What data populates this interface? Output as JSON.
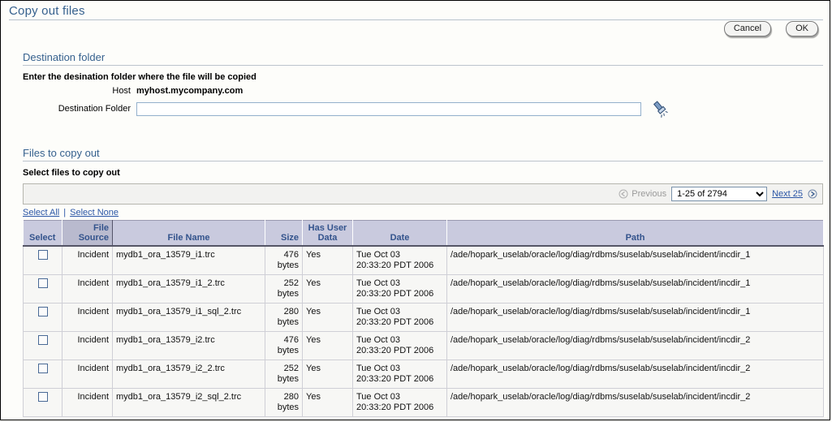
{
  "page": {
    "title": "Copy out files"
  },
  "top_actions": {
    "cancel_label": "Cancel",
    "ok_label": "OK"
  },
  "destination": {
    "section_title": "Destination folder",
    "instruction": "Enter the desination folder where the file will be copied",
    "host_label": "Host",
    "host_value": "myhost.mycompany.com",
    "folder_label": "Destination Folder",
    "folder_value": "",
    "folder_placeholder": "",
    "picker_icon": "flashlight-icon"
  },
  "files_section": {
    "section_title": "Files to copy out",
    "subtitle": "Select files to copy out"
  },
  "pagination": {
    "previous_label": "Previous",
    "previous_icon": "circle-left-arrow-icon",
    "range_value": "1-25 of 2794",
    "range_options": [
      "1-25 of 2794"
    ],
    "next_label": "Next 25",
    "next_icon": "circle-right-arrow-icon"
  },
  "selection_links": {
    "select_all": "Select All",
    "separator": "|",
    "select_none": "Select None"
  },
  "table": {
    "columns": [
      "Select",
      "File Source",
      "File Name",
      "Size",
      "Has User Data",
      "Date",
      "Path"
    ],
    "sorted_column": "File Source",
    "rows": [
      {
        "selected": false,
        "file_source": "Incident",
        "file_name": "mydb1_ora_13579_i1.trc",
        "size": "476 bytes",
        "has_user_data": "Yes",
        "date_line1": "Tue Oct 03",
        "date_line2": "20:33:20 PDT 2006",
        "path": "/ade/hopark_uselab/oracle/log/diag/rdbms/suselab/suselab/incident/incdir_1"
      },
      {
        "selected": false,
        "file_source": "Incident",
        "file_name": "mydb1_ora_13579_i1_2.trc",
        "size": "252 bytes",
        "has_user_data": "Yes",
        "date_line1": "Tue Oct 03",
        "date_line2": "20:33:20 PDT 2006",
        "path": "/ade/hopark_uselab/oracle/log/diag/rdbms/suselab/suselab/incident/incdir_1"
      },
      {
        "selected": false,
        "file_source": "Incident",
        "file_name": "mydb1_ora_13579_i1_sql_2.trc",
        "size": "280 bytes",
        "has_user_data": "Yes",
        "date_line1": "Tue Oct 03",
        "date_line2": "20:33:20 PDT 2006",
        "path": "/ade/hopark_uselab/oracle/log/diag/rdbms/suselab/suselab/incident/incdir_1"
      },
      {
        "selected": false,
        "file_source": "Incident",
        "file_name": "mydb1_ora_13579_i2.trc",
        "size": "476 bytes",
        "has_user_data": "Yes",
        "date_line1": "Tue Oct 03",
        "date_line2": "20:33:20 PDT 2006",
        "path": "/ade/hopark_uselab/oracle/log/diag/rdbms/suselab/suselab/incident/incdir_2"
      },
      {
        "selected": false,
        "file_source": "Incident",
        "file_name": "mydb1_ora_13579_i2_2.trc",
        "size": "252 bytes",
        "has_user_data": "Yes",
        "date_line1": "Tue Oct 03",
        "date_line2": "20:33:20 PDT 2006",
        "path": "/ade/hopark_uselab/oracle/log/diag/rdbms/suselab/suselab/incident/incdir_2"
      },
      {
        "selected": false,
        "file_source": "Incident",
        "file_name": "mydb1_ora_13579_i2_sql_2.trc",
        "size": "280 bytes",
        "has_user_data": "Yes",
        "date_line1": "Tue Oct 03",
        "date_line2": "20:33:20 PDT 2006",
        "path": "/ade/hopark_uselab/oracle/log/diag/rdbms/suselab/suselab/incident/incdir_2"
      }
    ]
  },
  "colors": {
    "title_blue": "#36618e",
    "header_blue": "#33538c",
    "link_blue": "#2b56a6",
    "header_bg": "#c9cade",
    "sorted_header_bg": "#b9bace",
    "row_bg": "#f7f7f5"
  }
}
